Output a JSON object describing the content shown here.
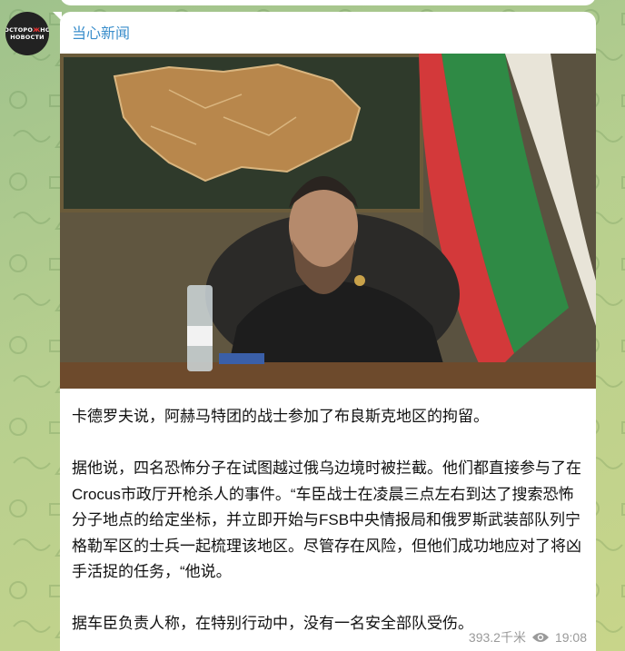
{
  "channel": {
    "avatar_text": "ОСТОРОЖНО\nНОВОСТИ",
    "name": "当心新闻"
  },
  "message": {
    "paragraphs": [
      "卡德罗夫说，阿赫马特团的战士参加了布良斯克地区的拘留。",
      "据他说，四名恐怖分子在试图越过俄乌边境时被拦截。他们都直接参与了在Crocus市政厅开枪杀人的事件。“车臣战士在凌晨三点左右到达了搜索恐怖分子地点的给定坐标，并立即开始与FSB中央情报局和俄罗斯武装部队列宁格勒军区的士兵一起梳理该地区。尽管存在风险，但他们成功地应对了将凶手活捉的任务，“他说。",
      "据车臣负责人称，在特别行动中，没有一名安全部队受伤。"
    ],
    "views": "393.2千米",
    "time": "19:08"
  },
  "colors": {
    "channel_name": "#3a8ecb",
    "flag_green": "#2f8a45",
    "flag_red": "#d3393a"
  },
  "icons": {
    "views": "eye-icon"
  }
}
